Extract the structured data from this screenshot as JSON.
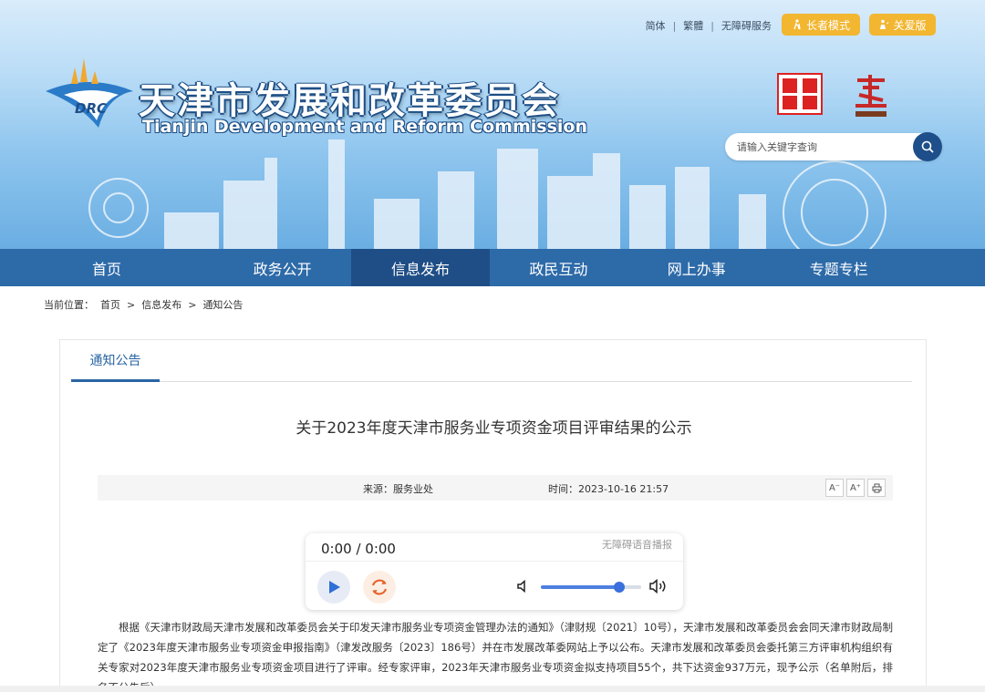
{
  "top_links": {
    "simplified": "简体",
    "traditional": "繁體",
    "accessible": "无障碍服务"
  },
  "pills": {
    "elder": "长者模式",
    "care": "关爱版"
  },
  "site": {
    "title": "天津市发展和改革委员会",
    "subtitle": "Tianjin Development and Reform Commission",
    "logo_text": "DRC"
  },
  "search": {
    "placeholder": "请输入关键字查询"
  },
  "nav": [
    "首页",
    "政务公开",
    "信息发布",
    "政民互动",
    "网上办事",
    "专题专栏"
  ],
  "nav_active_index": 2,
  "breadcrumb": {
    "label": "当前位置：",
    "items": [
      "首页",
      "信息发布",
      "通知公告"
    ],
    "sep": ">"
  },
  "section": {
    "tab": "通知公告"
  },
  "article": {
    "title": "关于2023年度天津市服务业专项资金项目评审结果的公示",
    "source": "来源：服务业处",
    "time": "时间：2023-10-16 21:57",
    "body": "根据《天津市财政局天津市发展和改革委员会关于印发天津市服务业专项资金管理办法的通知》（津财规〔2021〕10号），天津市发展和改革委员会会同天津市财政局制定了《2023年度天津市服务业专项资金申报指南》（津发改服务〔2023〕186号）并在市发展改革委网站上予以公布。天津市发展和改革委员会委托第三方评审机构组织有关专家对2023年度天津市服务业专项资金项目进行了评审。经专家评审，2023年天津市服务业专项资金拟支持项目55个，共下达资金937万元，现予公示（名单附后，排名不分先后）。"
  },
  "tools": {
    "font_smaller": "A⁻",
    "font_larger": "A⁺"
  },
  "player": {
    "time": "0:00 / 0:00",
    "tag": "无障碍语音播报",
    "volume": 0.78
  },
  "colors": {
    "nav": "#2d6aa8",
    "nav_active": "#1f4e86",
    "accent": "#2a65a4",
    "pill": "#f2b630"
  },
  "icons": [
    "search-icon",
    "elder-icon",
    "care-icon",
    "print-icon",
    "play-icon",
    "replay-icon",
    "volume-low-icon",
    "volume-high-icon"
  ]
}
